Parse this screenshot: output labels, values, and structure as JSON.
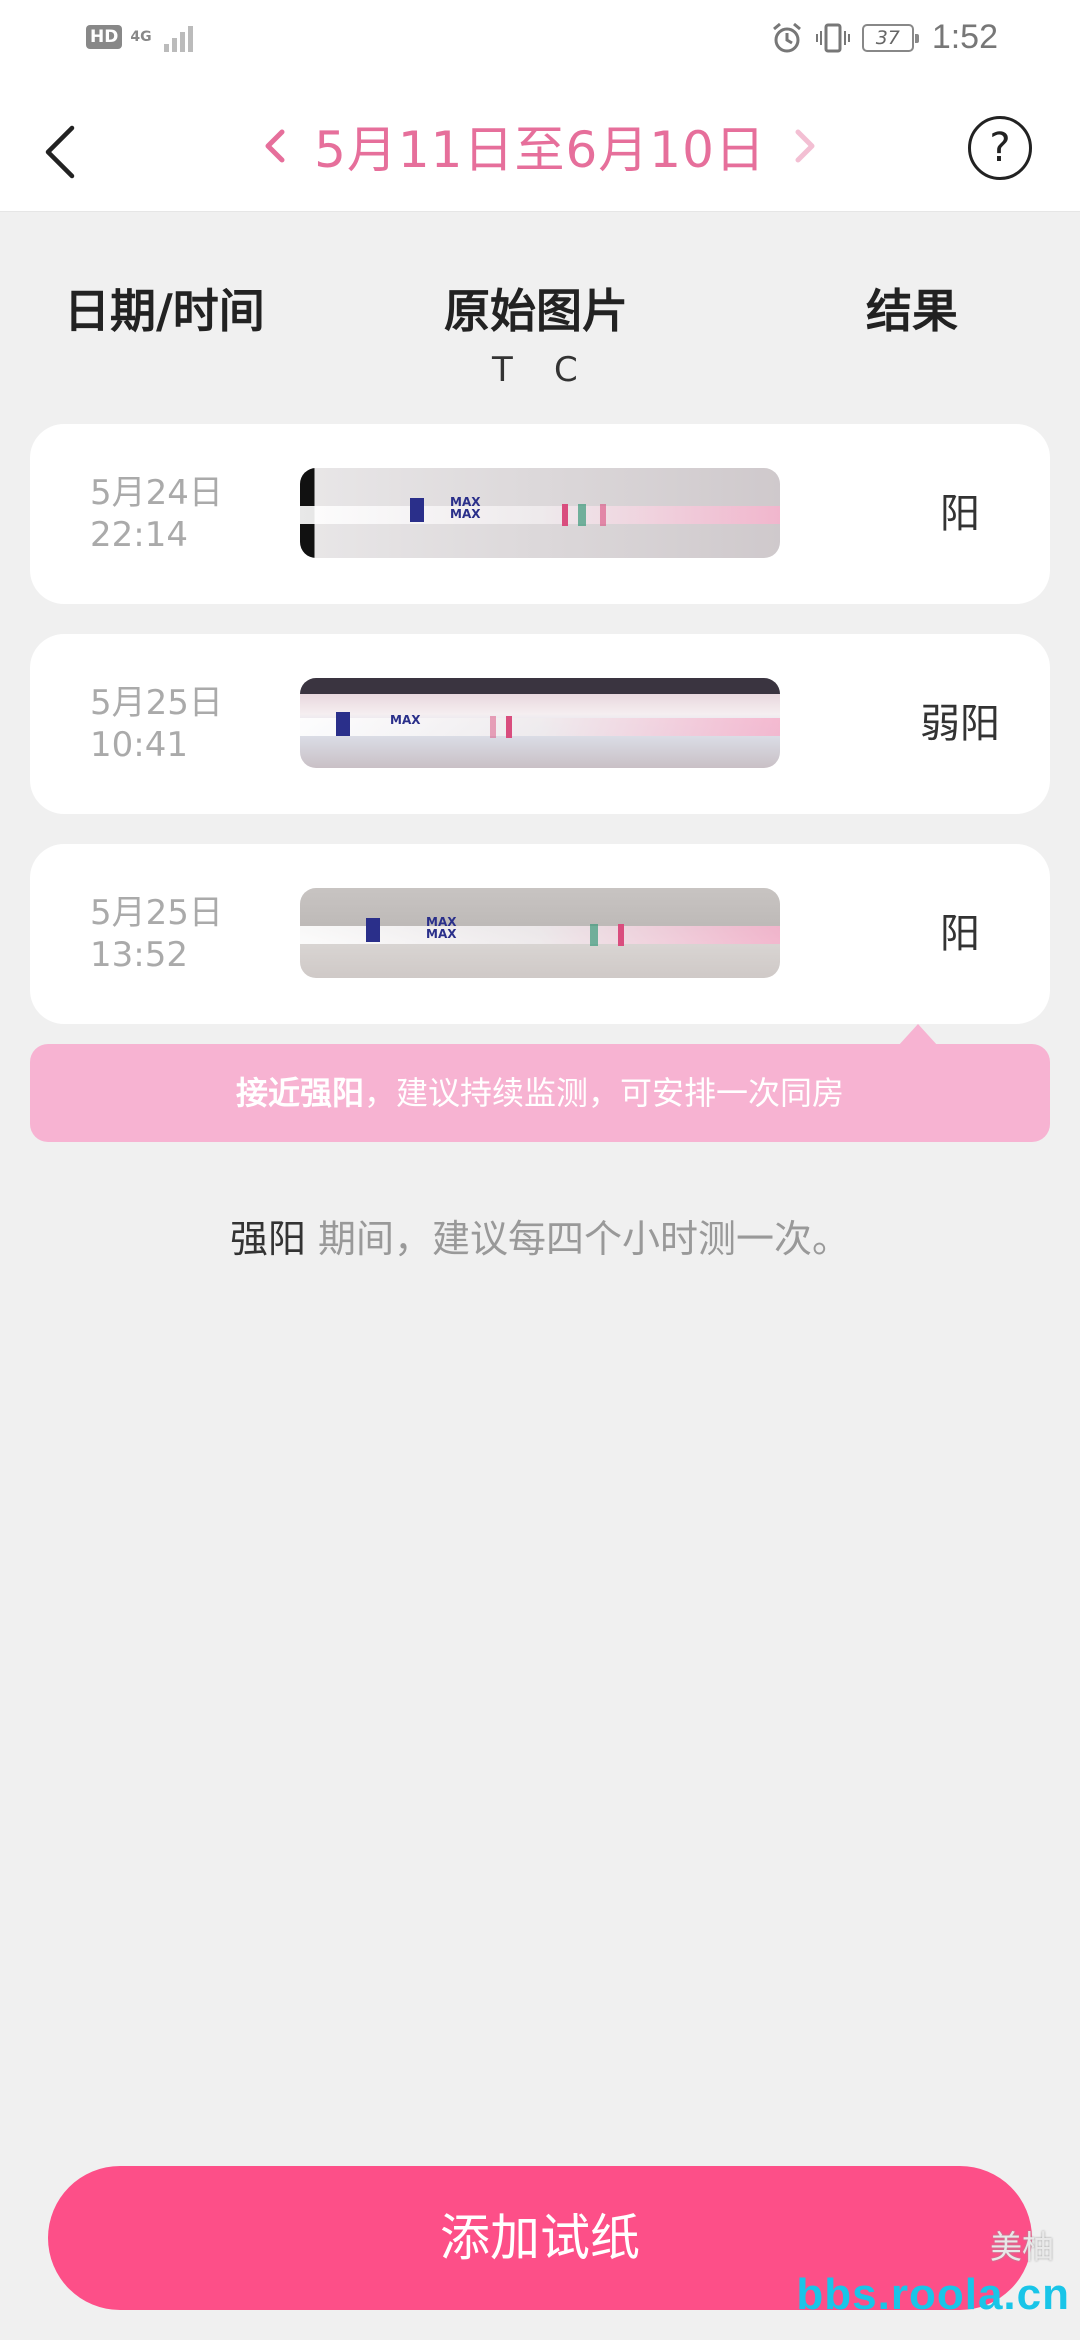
{
  "status_bar": {
    "hd": "HD",
    "network": "4G",
    "battery": "37",
    "time": "1:52"
  },
  "header": {
    "date_range": "5月11日至6月10日",
    "help": "?"
  },
  "columns": {
    "date": "日期/时间",
    "image": "原始图片",
    "result": "结果",
    "t_label": "T",
    "c_label": "C"
  },
  "records": [
    {
      "date": "5月24日",
      "time": "22:14",
      "result": "阳"
    },
    {
      "date": "5月25日",
      "time": "10:41",
      "result": "弱阳"
    },
    {
      "date": "5月25日",
      "time": "13:52",
      "result": "阳"
    }
  ],
  "tip": {
    "bold": "接近强阳",
    "rest": "，建议持续监测，可安排一次同房"
  },
  "advice": {
    "highlight": "强阳",
    "rest": " 期间，建议每四个小时测一次。"
  },
  "add_button": "添加试纸",
  "watermark": {
    "brand": "美柚",
    "site": "bbs.roola.cn"
  },
  "colors": {
    "accent": "#fd4f88",
    "date_range": "#e66f9b",
    "tip_bg": "#f7b3d2"
  }
}
